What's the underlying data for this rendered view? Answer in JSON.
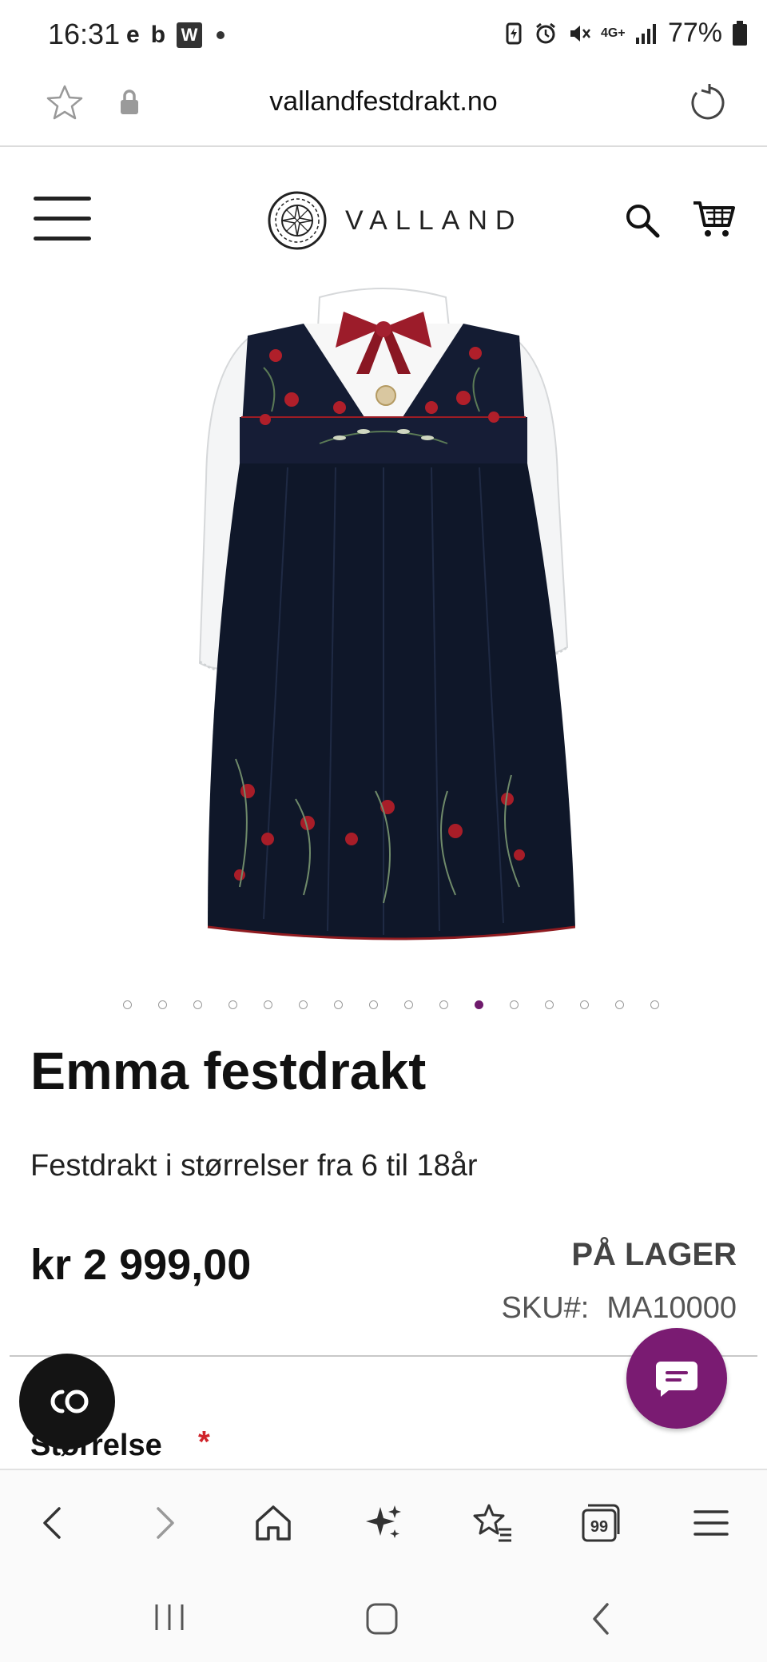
{
  "status_bar": {
    "time": "16:31",
    "app_icons": [
      "e",
      "b",
      "W"
    ],
    "network": "4G+",
    "battery": "77%"
  },
  "browser": {
    "url": "vallandfestdrakt.no"
  },
  "site": {
    "logo_text": "VALLAND"
  },
  "carousel": {
    "total_dots": 16,
    "active_index": 10
  },
  "product": {
    "title": "Emma festdrakt",
    "subtitle": "Festdrakt i størrelser fra 6 til 18år",
    "price": "kr 2 999,00",
    "stock": "PÅ LAGER",
    "sku_label": "SKU#:",
    "sku_value": "MA10000",
    "size_label": "Størrelse",
    "required_mark": "*"
  },
  "floating": {
    "co_label": "CO"
  },
  "bottom_toolbar": {
    "tabs_count": "99"
  },
  "colors": {
    "accent": "#7a1b72",
    "required": "#d0242b"
  }
}
